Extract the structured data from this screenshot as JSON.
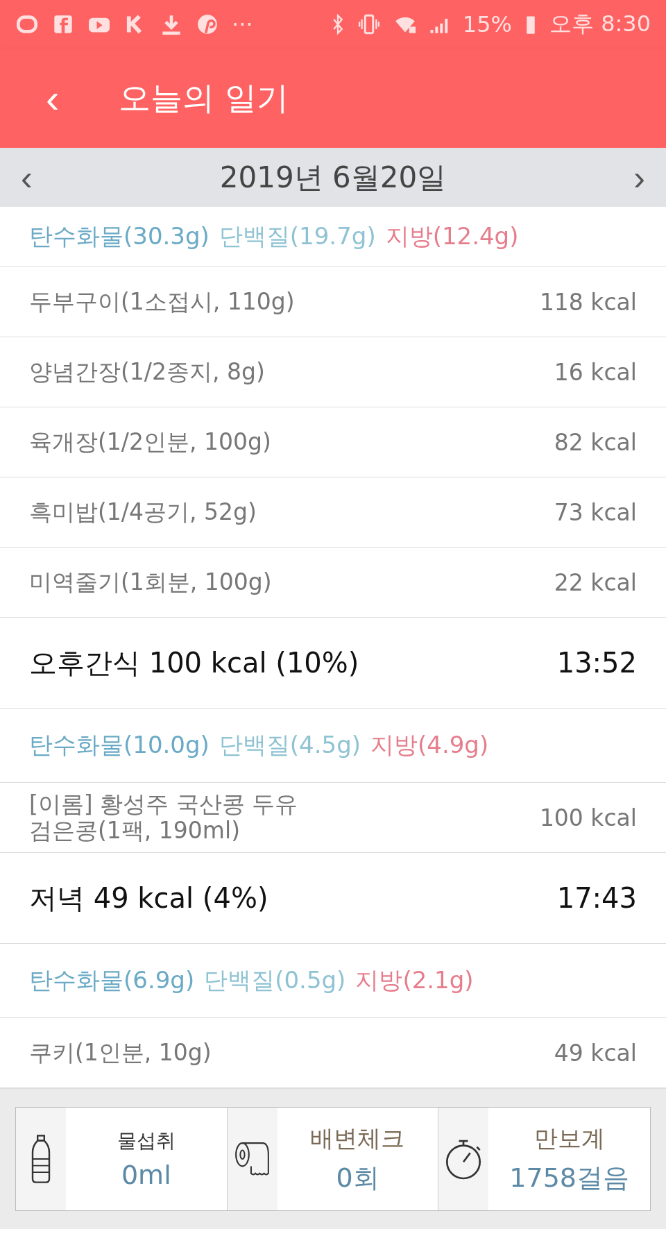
{
  "status_bar": {
    "more": "···",
    "battery": "15%",
    "time": "오후 8:30"
  },
  "header": {
    "back": "‹",
    "title": "오늘의 일기"
  },
  "date_bar": {
    "prev": "‹",
    "date": "2019년 6월20일",
    "next": "›"
  },
  "sections": [
    {
      "macros": [
        {
          "text": "탄수화물(30.3g)",
          "color": "#6aaac6"
        },
        {
          "text": "단백질(19.7g)",
          "color": "#8fc3d3"
        },
        {
          "text": "지방(12.4g)",
          "color": "#e67d8c"
        }
      ],
      "foods": [
        {
          "name": "두부구이(1소접시, 110g)",
          "kcal": "118 kcal"
        },
        {
          "name": "양념간장(1/2종지, 8g)",
          "kcal": "16 kcal"
        },
        {
          "name": "육개장(1/2인분, 100g)",
          "kcal": "82 kcal"
        },
        {
          "name": "흑미밥(1/4공기, 52g)",
          "kcal": "73 kcal"
        },
        {
          "name": "미역줄기(1회분, 100g)",
          "kcal": "22 kcal"
        }
      ]
    },
    {
      "meal": {
        "title": "오후간식 100 kcal (10%)",
        "time": "13:52"
      },
      "macros": [
        {
          "text": "탄수화물(10.0g)",
          "color": "#6aaac6"
        },
        {
          "text": "단백질(4.5g)",
          "color": "#8fc3d3"
        },
        {
          "text": "지방(4.9g)",
          "color": "#e67d8c"
        }
      ],
      "foods": [
        {
          "name": "[이롬] 황성주 국산콩 두유 검은콩(1팩, 190ml)",
          "kcal": "100 kcal"
        }
      ]
    },
    {
      "meal": {
        "title": "저녁 49 kcal (4%)",
        "time": "17:43"
      },
      "macros": [
        {
          "text": "탄수화물(6.9g)",
          "color": "#6aaac6"
        },
        {
          "text": "단백질(0.5g)",
          "color": "#8fc3d3"
        },
        {
          "text": "지방(2.1g)",
          "color": "#e67d8c"
        }
      ],
      "foods": [
        {
          "name": "쿠키(1인분, 10g)",
          "kcal": "49 kcal"
        }
      ]
    }
  ],
  "trackers": [
    {
      "kind": "water",
      "label": "물섭취",
      "value": "0ml"
    },
    {
      "kind": "toilet",
      "label": "배변체크",
      "value": "0회"
    },
    {
      "kind": "steps",
      "label": "만보계",
      "value": "1758걸음"
    }
  ]
}
